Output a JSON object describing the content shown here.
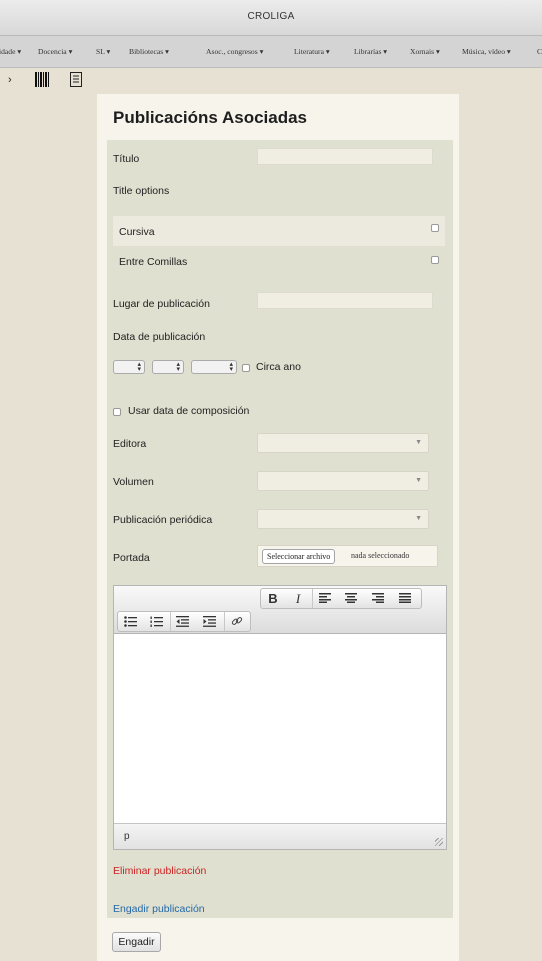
{
  "window": {
    "title": "CROLIGA"
  },
  "menubar": {
    "items": [
      {
        "label": "idade ▾"
      },
      {
        "label": "Docencia ▾"
      },
      {
        "label": "SL ▾"
      },
      {
        "label": "Bibliotecas ▾"
      },
      {
        "label": "Asoc., congresos ▾"
      },
      {
        "label": "Literatura ▾"
      },
      {
        "label": "Librarías ▾"
      },
      {
        "label": "Xornais ▾"
      },
      {
        "label": "Música, vídeo ▾"
      },
      {
        "label": "C"
      }
    ]
  },
  "toolbar": {
    "icons": [
      "arrow-icon",
      "barcode-icon",
      "document-icon"
    ]
  },
  "form": {
    "heading": "Publicacións Asociadas",
    "titulo_label": "Título",
    "titulo_value": "",
    "title_options_label": "Title options",
    "cursiva_label": "Cursiva",
    "cursiva_checked": false,
    "comillas_label": "Entre Comillas",
    "comillas_checked": false,
    "lugar_label": "Lugar de publicación",
    "lugar_value": "",
    "data_label": "Data de publicación",
    "circa_label": "Circa ano",
    "circa_checked": false,
    "usar_label": "Usar data de composición",
    "usar_checked": false,
    "editora_label": "Editora",
    "editora_value": "",
    "volumen_label": "Volumen",
    "volumen_value": "",
    "periodica_label": "Publicación periódica",
    "periodica_value": "",
    "portada_label": "Portada",
    "file_button": "Seleccionar archivo",
    "file_status": "nada seleccionado",
    "editor": {
      "bold": "B",
      "italic": "I",
      "path": "p",
      "content": ""
    },
    "remove_link": "Eliminar publicación",
    "add_link": "Engadir publicación",
    "add_button": "Engadir"
  }
}
